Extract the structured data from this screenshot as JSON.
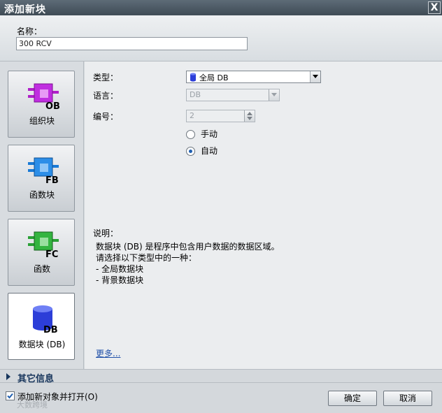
{
  "window": {
    "title": "添加新块",
    "close_symbol": "X"
  },
  "name_section": {
    "label": "名称：",
    "value": "300 RCV"
  },
  "block_types": [
    {
      "id": "ob",
      "label": "组织块",
      "code": "OB",
      "color": "#b020c8"
    },
    {
      "id": "fb",
      "label": "函数块",
      "code": "FB",
      "color": "#1a7ad6"
    },
    {
      "id": "fc",
      "label": "函数",
      "code": "FC",
      "color": "#2aa036"
    },
    {
      "id": "db",
      "label": "数据块 (DB)",
      "code": "DB",
      "color": "#2c3ed8",
      "selected": true
    }
  ],
  "properties": {
    "type_label": "类型：",
    "type_value": "全局 DB",
    "language_label": "语言：",
    "language_value": "DB",
    "number_label": "编号：",
    "number_value": "2",
    "radio_manual": "手动",
    "radio_auto": "自动",
    "radio_selected": "auto"
  },
  "description": {
    "title": "说明：",
    "lines": [
      "数据块 (DB) 是程序中包含用户数据的数据区域。",
      "请选择以下类型中的一种：",
      "- 全局数据块",
      "- 背景数据块"
    ],
    "more_link": "更多..."
  },
  "more_info": {
    "label": "其它信息"
  },
  "footer": {
    "checkbox_label": "添加新对象并打开(O)",
    "checkbox_checked": true,
    "ok_button": "确定",
    "cancel_button": "取消",
    "watermark": "大数跨境"
  }
}
